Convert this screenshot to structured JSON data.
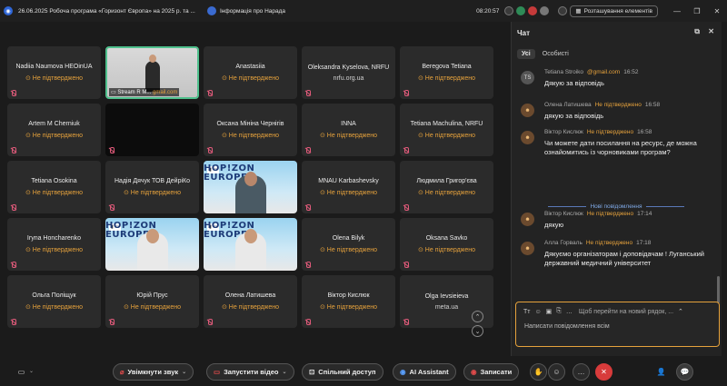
{
  "titlebar": {
    "title": "26.06.2025 Робоча програма «Горизонт Європа» на 2025 р. та ...",
    "info_label": "Інформація про Нарада",
    "time": "08:20:57",
    "layout_button": "Розташування елементів"
  },
  "tiles": [
    {
      "name": "Nadiia Naumova HEOinUA",
      "status": "Не підтверджено",
      "type": "text"
    },
    {
      "name": "",
      "status": "",
      "type": "stage",
      "stream_label": "Stream R M...",
      "stream_suffix": "gmail.com"
    },
    {
      "name": "Anastasiia",
      "status": "Не підтверджено",
      "type": "text"
    },
    {
      "name": "Oleksandra Kyselova, NRFU",
      "status": "nrfu.org.ua",
      "type": "text"
    },
    {
      "name": "Beregova Tetiana",
      "status": "Не підтверджено",
      "type": "text"
    },
    {
      "name": "Artem M Cherniuk",
      "status": "Не підтверджено",
      "type": "text"
    },
    {
      "name": "",
      "status": "",
      "type": "dark"
    },
    {
      "name": "Оксана Мініна Чернігів",
      "status": "Не підтверджено",
      "type": "text"
    },
    {
      "name": "INNA",
      "status": "Не підтверджено",
      "type": "text"
    },
    {
      "name": "Tetiana Machulina, NRFU",
      "status": "Не підтверджено",
      "type": "text"
    },
    {
      "name": "Tetiana Osokina",
      "status": "Не підтверджено",
      "type": "text"
    },
    {
      "name": "Надія Дячук ТОВ ДейріКо",
      "status": "Не підтверджено",
      "type": "text"
    },
    {
      "name": "",
      "status": "",
      "type": "video-man",
      "banner": "HOP!ZON EUROPE"
    },
    {
      "name": "MNAU Karbashevsky",
      "status": "Не підтверджено",
      "type": "text"
    },
    {
      "name": "Людмила Григор'єва",
      "status": "Не підтверджено",
      "type": "text"
    },
    {
      "name": "Iryna Honcharenko",
      "status": "Не підтверджено",
      "type": "text"
    },
    {
      "name": "",
      "status": "",
      "type": "video-woman",
      "banner": "HOP!ZON EUROPE"
    },
    {
      "name": "",
      "status": "",
      "type": "video-woman",
      "banner": "HOP!ZON EUROPE"
    },
    {
      "name": "Olena Bilyk",
      "status": "Не підтверджено",
      "type": "text"
    },
    {
      "name": "Oksana Savko",
      "status": "Не підтверджено",
      "type": "text"
    },
    {
      "name": "Ольга Поліщук",
      "status": "Не підтверджено",
      "type": "text"
    },
    {
      "name": "Юрій Прус",
      "status": "Не підтверджено",
      "type": "text"
    },
    {
      "name": "Олена Латишева",
      "status": "Не підтверджено",
      "type": "text"
    },
    {
      "name": "Віктор Кислюк",
      "status": "Не підтверджено",
      "type": "text"
    },
    {
      "name": "Olga Ievsieieva",
      "status": "meta.ua",
      "type": "text"
    }
  ],
  "chat": {
    "title": "Чат",
    "tab_all": "Усі",
    "tab_private": "Особисті",
    "messages": [
      {
        "initials": "TS",
        "author": "Tetiana Stroiko",
        "status": "@gmail.com",
        "time": "16:52",
        "text": "Дякую за відповідь"
      },
      {
        "initials": "",
        "author": "Олена Латишева",
        "status": "Не підтверджено",
        "time": "16:58",
        "text": "дякую за відповідь"
      },
      {
        "initials": "",
        "author": "Віктор Кислюк",
        "status": "Не підтверджено",
        "time": "16:58",
        "text": "Чи можете дати посилання на ресурс, де можна ознайомитись із чорновиками програм?"
      },
      {
        "initials": "",
        "author": "Віктор Кислюк",
        "status": "Не підтверджено",
        "time": "17:14",
        "text": "дякую"
      },
      {
        "initials": "",
        "author": "Алла Горваль",
        "status": "Не підтверджено",
        "time": "17:18",
        "text": "Дякуємо організаторам і доповідачам ! Луганський  державний медичний університет"
      }
    ],
    "new_messages": "Нові повідомлення",
    "hint": "Щоб перейти на новий рядок, ...",
    "placeholder": "Написати повідомлення всім"
  },
  "controls": {
    "unmute": "Увімкнути звук",
    "video": "Запустити відео",
    "share": "Спільний доступ",
    "ai": "AI Assistant",
    "record": "Записати"
  }
}
